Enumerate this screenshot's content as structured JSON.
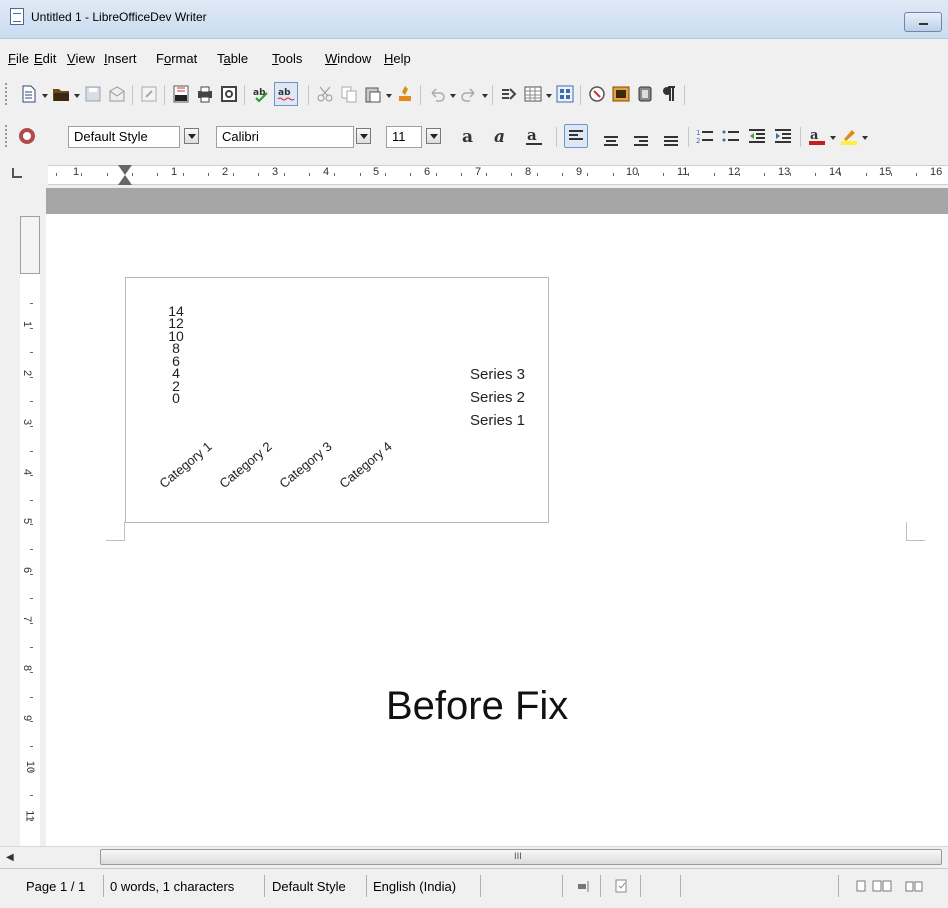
{
  "window": {
    "title": "Untitled 1 - LibreOfficeDev Writer"
  },
  "menu": [
    {
      "label": "File",
      "accel": "F",
      "rest": "ile"
    },
    {
      "label": "Edit",
      "accel": "E",
      "rest": "dit"
    },
    {
      "label": "View",
      "accel": "V",
      "rest": "iew"
    },
    {
      "label": "Insert",
      "accel": "I",
      "rest": "nsert"
    },
    {
      "label": "Format",
      "accel": "o",
      "pre": "F",
      "rest": "rmat"
    },
    {
      "label": "Table",
      "accel": "a",
      "pre": "T",
      "rest": "ble"
    },
    {
      "label": "Tools",
      "accel": "T",
      "rest": "ools"
    },
    {
      "label": "Window",
      "accel": "W",
      "rest": "indow"
    },
    {
      "label": "Help",
      "accel": "H",
      "rest": "elp"
    }
  ],
  "formatting": {
    "paragraph_style": "Default Style",
    "font_name": "Calibri",
    "font_size": "11"
  },
  "ruler": {
    "h_numbers": [
      "1",
      "1",
      "2",
      "3",
      "4",
      "5",
      "6",
      "7",
      "8",
      "9",
      "10",
      "11",
      "12",
      "13",
      "14",
      "15",
      "16"
    ],
    "v_numbers": [
      "1",
      "2",
      "3",
      "4",
      "5",
      "6",
      "7",
      "8",
      "9",
      "10",
      "11"
    ]
  },
  "chart_data": {
    "type": "bar",
    "categories": [
      "Category 1",
      "Category 2",
      "Category 3",
      "Category 4"
    ],
    "y_tick_labels": [
      "14",
      "12",
      "10",
      "8",
      "6",
      "4",
      "2",
      "0"
    ],
    "series": [
      {
        "name": "Series 3"
      },
      {
        "name": "Series 2"
      },
      {
        "name": "Series 1"
      }
    ],
    "legend_position": "right",
    "grid": false
  },
  "document": {
    "caption": "Before Fix"
  },
  "status": {
    "page": "Page 1 / 1",
    "words": "0 words, 1 characters",
    "style": "Default Style",
    "language": "English (India)"
  },
  "scrollbar": {
    "grip": "III"
  },
  "colors": {
    "titlebar": "#c9dcf0",
    "doc_band": "#a6a6a6",
    "accent": "#6f95c8"
  }
}
